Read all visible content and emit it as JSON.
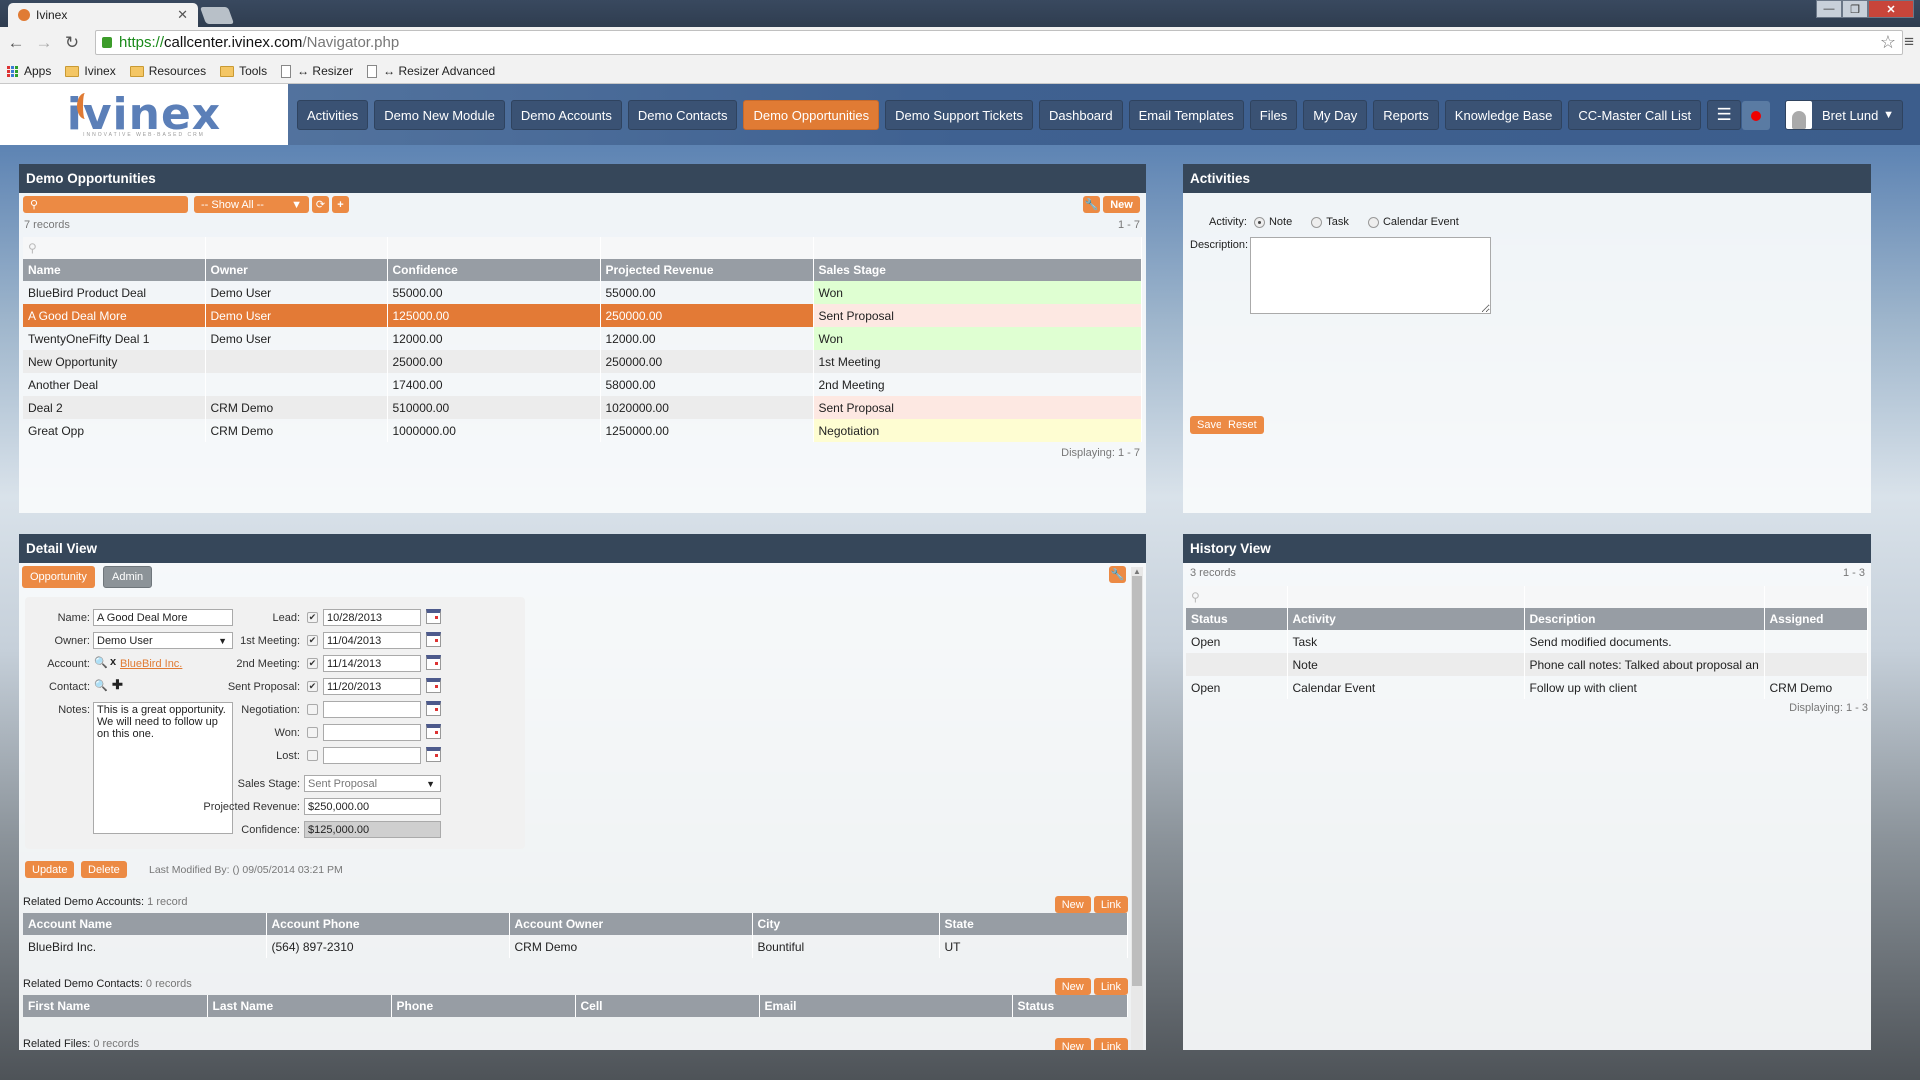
{
  "browser": {
    "tab_title": "Ivinex",
    "url_scheme": "https://",
    "url_host": "callcenter.ivinex.com",
    "url_path": "/Navigator.php",
    "bookmarks": [
      {
        "label": "Apps",
        "icon": "apps-grid-icon"
      },
      {
        "label": "Ivinex",
        "icon": "folder-icon"
      },
      {
        "label": "Resources",
        "icon": "folder-icon"
      },
      {
        "label": "Tools",
        "icon": "folder-icon"
      },
      {
        "label": "↔ Resizer",
        "icon": "page-icon"
      },
      {
        "label": "↔ Resizer Advanced",
        "icon": "page-icon"
      }
    ]
  },
  "app": {
    "logo_text": "ivinex",
    "logo_tagline": "INNOVATIVE WEB-BASED CRM",
    "nav": [
      {
        "label": "Activities",
        "active": false
      },
      {
        "label": "Demo New Module",
        "active": false
      },
      {
        "label": "Demo Accounts",
        "active": false
      },
      {
        "label": "Demo Contacts",
        "active": false
      },
      {
        "label": "Demo Opportunities",
        "active": true
      },
      {
        "label": "Demo Support Tickets",
        "active": false
      },
      {
        "label": "Dashboard",
        "active": false
      },
      {
        "label": "Email Templates",
        "active": false
      },
      {
        "label": "Files",
        "active": false
      },
      {
        "label": "My Day",
        "active": false
      },
      {
        "label": "Reports",
        "active": false
      },
      {
        "label": "Knowledge Base",
        "active": false
      },
      {
        "label": "CC-Master Call List",
        "active": false
      }
    ],
    "user_name": "Bret Lund",
    "accent_color": "#e07b34"
  },
  "opportunities": {
    "title": "Demo Opportunities",
    "filter_label": "-- Show All --",
    "new_label": "New",
    "record_count": "7 records",
    "range": "1 - 7",
    "displaying": "Displaying: 1 - 7",
    "columns": [
      "Name",
      "Owner",
      "Confidence",
      "Projected Revenue",
      "Sales Stage"
    ],
    "rows": [
      {
        "name": "BlueBird Product Deal",
        "owner": "Demo User",
        "confidence": "55000.00",
        "revenue": "55000.00",
        "stage": "Won",
        "stage_class": "won"
      },
      {
        "name": "A Good Deal More",
        "owner": "Demo User",
        "confidence": "125000.00",
        "revenue": "250000.00",
        "stage": "Sent Proposal",
        "stage_class": "sent",
        "selected": true
      },
      {
        "name": "TwentyOneFifty Deal 1",
        "owner": "Demo User",
        "confidence": "12000.00",
        "revenue": "12000.00",
        "stage": "Won",
        "stage_class": "won"
      },
      {
        "name": "New Opportunity",
        "owner": "",
        "confidence": "25000.00",
        "revenue": "250000.00",
        "stage": "1st Meeting",
        "stage_class": ""
      },
      {
        "name": "Another Deal",
        "owner": "",
        "confidence": "17400.00",
        "revenue": "58000.00",
        "stage": "2nd Meeting",
        "stage_class": ""
      },
      {
        "name": "Deal 2",
        "owner": "CRM Demo",
        "confidence": "510000.00",
        "revenue": "1020000.00",
        "stage": "Sent Proposal",
        "stage_class": "sent"
      },
      {
        "name": "Great Opp",
        "owner": "CRM Demo",
        "confidence": "1000000.00",
        "revenue": "1250000.00",
        "stage": "Negotiation",
        "stage_class": "neg"
      }
    ]
  },
  "activities": {
    "title": "Activities",
    "activity_label": "Activity:",
    "options": [
      "Note",
      "Task",
      "Calendar Event"
    ],
    "selected": "Note",
    "description_label": "Description:",
    "description_value": "",
    "save_label": "Save",
    "reset_label": "Reset"
  },
  "detail": {
    "title": "Detail View",
    "tabs": [
      "Opportunity",
      "Admin"
    ],
    "labels": {
      "name": "Name:",
      "owner": "Owner:",
      "account": "Account:",
      "contact": "Contact:",
      "notes": "Notes:",
      "lead": "Lead:",
      "meeting1": "1st Meeting:",
      "meeting2": "2nd Meeting:",
      "sent": "Sent Proposal:",
      "negotiation": "Negotiation:",
      "won": "Won:",
      "lost": "Lost:",
      "stage": "Sales Stage:",
      "revenue": "Projected Revenue:",
      "confidence": "Confidence:"
    },
    "values": {
      "name": "A Good Deal More",
      "owner": "Demo User",
      "account": "BlueBird Inc.",
      "notes": "This is a great opportunity. We will need to follow up on this one.",
      "lead": "10/28/2013",
      "meeting1": "11/04/2013",
      "meeting2": "11/14/2013",
      "sent": "11/20/2013",
      "negotiation": "",
      "won": "",
      "lost": "",
      "stage": "Sent Proposal",
      "revenue": "$250,000.00",
      "confidence": "$125,000.00"
    },
    "checks": {
      "lead": true,
      "meeting1": true,
      "meeting2": true,
      "sent": true,
      "negotiation": false,
      "won": false,
      "lost": false
    },
    "update_label": "Update",
    "delete_label": "Delete",
    "last_modified": "Last Modified By: () 09/05/2014 03:21 PM",
    "related_accounts": {
      "label": "Related Demo Accounts:",
      "count": "1 record",
      "columns": [
        "Account Name",
        "Account Phone",
        "Account Owner",
        "City",
        "State"
      ],
      "rows": [
        [
          "BlueBird Inc.",
          "(564) 897-2310",
          "CRM Demo",
          "Bountiful",
          "UT"
        ]
      ]
    },
    "related_contacts": {
      "label": "Related Demo Contacts:",
      "count": "0 records",
      "columns": [
        "First Name",
        "Last Name",
        "Phone",
        "Cell",
        "Email",
        "Status"
      ]
    },
    "related_files": {
      "label": "Related Files:",
      "count": "0 records"
    },
    "new_label": "New",
    "link_label": "Link"
  },
  "history": {
    "title": "History View",
    "record_count": "3 records",
    "range": "1 - 3",
    "displaying": "Displaying: 1 - 3",
    "columns": [
      "Status",
      "Activity",
      "Description",
      "Assigned"
    ],
    "rows": [
      [
        "Open",
        "Task",
        "Send modified documents.",
        ""
      ],
      [
        "",
        "Note",
        "Phone call notes: Talked about proposal an",
        ""
      ],
      [
        "Open",
        "Calendar Event",
        "Follow up with client",
        "CRM Demo"
      ]
    ]
  }
}
